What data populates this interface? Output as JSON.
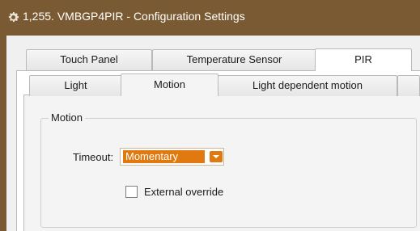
{
  "window": {
    "title": "1,255. VMBGP4PIR - Configuration Settings"
  },
  "outer_tabs": [
    {
      "label": "Touch Panel",
      "selected": false
    },
    {
      "label": "Temperature Sensor",
      "selected": false
    },
    {
      "label": "PIR",
      "selected": true
    }
  ],
  "inner_tabs": [
    {
      "label": "Light",
      "selected": false
    },
    {
      "label": "Motion",
      "selected": true
    },
    {
      "label": "Light dependent motion",
      "selected": false
    }
  ],
  "motion_group": {
    "label": "Motion",
    "timeout_label": "Timeout:",
    "timeout_value": "Momentary",
    "external_override_label": "External override",
    "external_override_checked": false
  },
  "icons": {
    "title": "gear-icon",
    "dropdown": "chevron-down-icon"
  },
  "colors": {
    "titlebar": "#7a5a32",
    "accent": "#e07a10"
  }
}
